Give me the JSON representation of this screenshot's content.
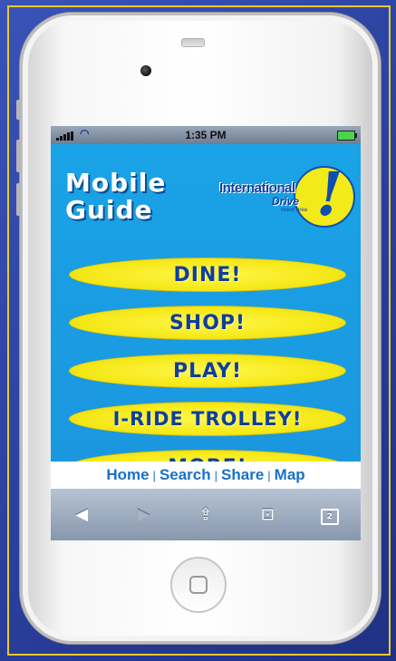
{
  "status": {
    "time": "1:35 PM"
  },
  "header": {
    "title_line1": "Mobile",
    "title_line2": "Guide",
    "logo_line1": "International",
    "logo_line2": "Drive",
    "logo_line3": "resort area"
  },
  "menu": [
    {
      "label": "DINE!"
    },
    {
      "label": "SHOP!"
    },
    {
      "label": "PLAY!"
    },
    {
      "label": "I-RIDE TROLLEY!"
    },
    {
      "label": "MORE!"
    }
  ],
  "footer_links": [
    "Home",
    "Search",
    "Share",
    "Map"
  ],
  "toolbar": {
    "back": "◀",
    "forward": "▶",
    "share": "⇪",
    "bookmarks": "⊡",
    "tabs": "2"
  },
  "colors": {
    "content_bg": "#1aa3e6",
    "menu_yellow": "#f6e91a",
    "menu_text": "#0e3f9b",
    "link_blue": "#1a70c9"
  }
}
